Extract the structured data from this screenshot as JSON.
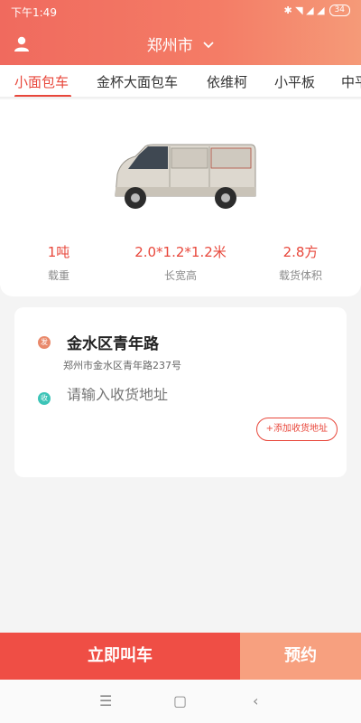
{
  "status_bar": {
    "time": "下午1:49",
    "icons_text": "✱ ◥ ◢ ◢",
    "battery": "34"
  },
  "header": {
    "city": "郑州市"
  },
  "tabs": [
    {
      "label": "小面包车",
      "active": true
    },
    {
      "label": "金杯大面包车",
      "active": false
    },
    {
      "label": "依维柯",
      "active": false
    },
    {
      "label": "小平板",
      "active": false
    },
    {
      "label": "中平",
      "active": false
    }
  ],
  "vehicle": {
    "specs": [
      {
        "value": "1吨",
        "label": "载重"
      },
      {
        "value": "2.0*1.2*1.2米",
        "label": "长宽高"
      },
      {
        "value": "2.8方",
        "label": "载货体积"
      }
    ]
  },
  "address": {
    "from_badge": "发",
    "to_badge": "收",
    "from_title": "金水区青年路",
    "from_detail": "郑州市金水区青年路237号",
    "to_placeholder": "请输入收货地址",
    "add_button": "+添加收货地址"
  },
  "actions": {
    "call": "立即叫车",
    "reserve": "预约"
  },
  "navbar": {
    "menu": "☰",
    "home": "▢",
    "back": "‹"
  },
  "colors": {
    "accent": "#e8473b",
    "header_start": "#f06a5e",
    "reserve": "#f7a07f"
  }
}
